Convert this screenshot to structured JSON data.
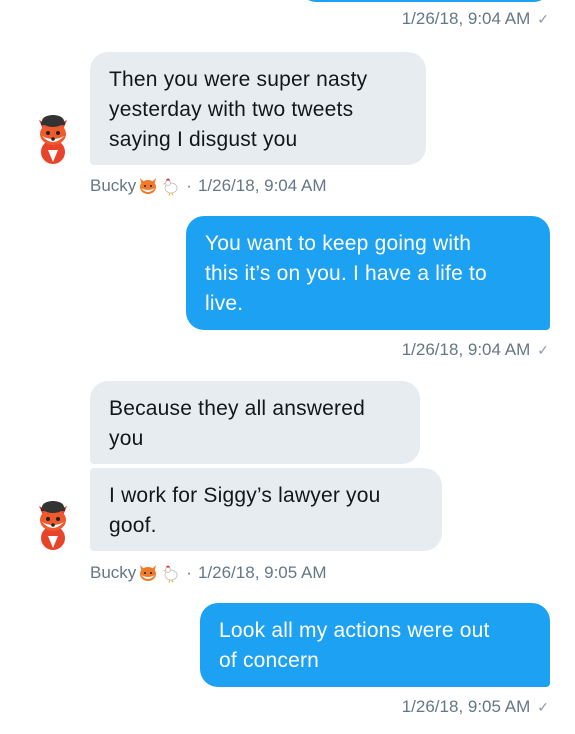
{
  "top_message": {
    "timestamp": "1/26/18, 9:04 AM"
  },
  "group1": {
    "sender": "Bucky",
    "sender_emoji": [
      "fox-face",
      "rooster"
    ],
    "timestamp": "1/26/18, 9:04 AM",
    "message_lines": [
      "Then you were super nasty",
      "yesterday with two tweets",
      "saying I disgust you"
    ]
  },
  "outgoing1": {
    "lines": [
      "You want to keep going with",
      "this it’s on you. I have a life to",
      "live."
    ],
    "timestamp": "1/26/18, 9:04 AM"
  },
  "group2": {
    "sender": "Bucky",
    "sender_emoji": [
      "fox-face",
      "rooster"
    ],
    "timestamp": "1/26/18, 9:05 AM",
    "message1_lines": [
      "Because they all answered",
      "you"
    ],
    "message2_lines": [
      "I work for Siggy’s lawyer you",
      "goof."
    ]
  },
  "outgoing2": {
    "lines": [
      "Look all my actions were out",
      "of concern"
    ],
    "timestamp": "1/26/18, 9:05 AM"
  },
  "check_glyph": "✓",
  "separator": "·",
  "colors": {
    "outgoing": "#1da1f2",
    "incoming": "#e6ecf0",
    "meta": "#657786"
  }
}
